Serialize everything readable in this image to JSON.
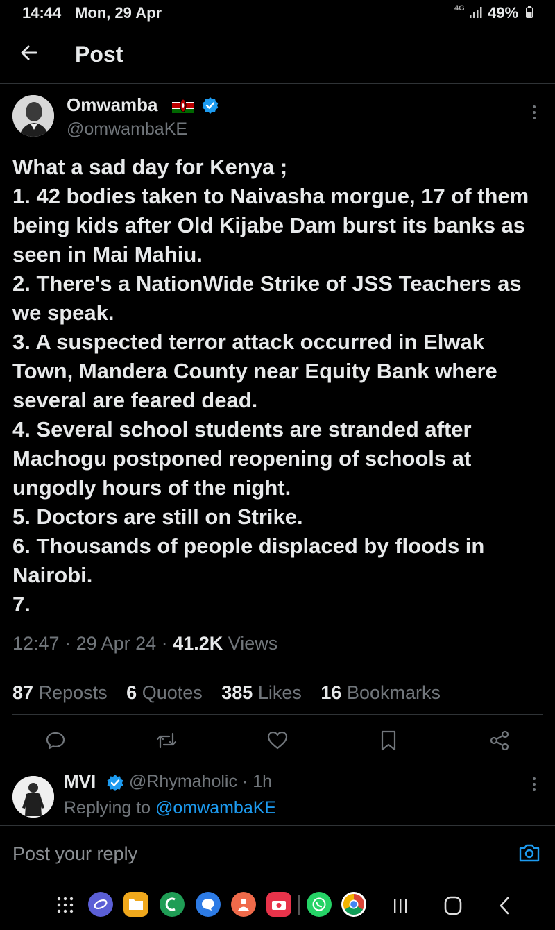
{
  "status_bar": {
    "time": "14:44",
    "date": "Mon, 29 Apr",
    "network": "4G",
    "battery": "49%"
  },
  "header": {
    "title": "Post"
  },
  "post": {
    "author_name": "Omwamba",
    "author_handle": "@omwambaKE",
    "text": "What a sad day for Kenya ;\n1. 42 bodies taken to Naivasha morgue, 17 of them being kids after Old Kijabe Dam burst its banks as seen in Mai Mahiu.\n2. There's a NationWide Strike of JSS Teachers as we speak.\n3. A suspected terror attack occurred in Elwak Town, Mandera County near Equity Bank where several are feared dead.\n4. Several school students are stranded after Machogu postponed reopening of schools at ungodly hours of the night.\n5. Doctors are still on Strike.\n6. Thousands of people displaced by floods in Nairobi.\n7.",
    "time": "12:47",
    "date": "29 Apr 24",
    "views_count": "41.2K",
    "views_label": "Views",
    "separator": " · "
  },
  "stats": {
    "reposts_count": "87",
    "reposts_label": "Reposts",
    "quotes_count": "6",
    "quotes_label": "Quotes",
    "likes_count": "385",
    "likes_label": "Likes",
    "bookmarks_count": "16",
    "bookmarks_label": "Bookmarks"
  },
  "actions": [
    "reply-icon",
    "repost-icon",
    "like-icon",
    "bookmark-icon",
    "share-icon"
  ],
  "reply": {
    "author_name": "MVI",
    "author_handle": "@Rhymaholic",
    "time": "· 1h",
    "replying_label": "Replying to",
    "replying_to": "@omwambaKE"
  },
  "composer": {
    "placeholder": "Post your reply"
  },
  "colors": {
    "accent": "#1d9bf0",
    "background": "#000000",
    "text": "#e7e9ea",
    "muted": "#71767b",
    "divider": "#2f3336"
  }
}
